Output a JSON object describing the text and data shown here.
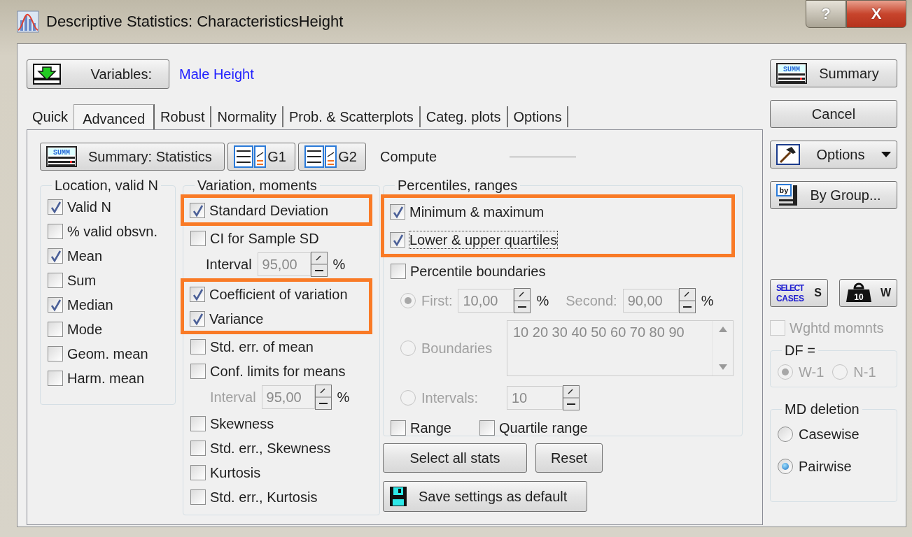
{
  "window": {
    "title": "Descriptive Statistics: CharacteristicsHeight",
    "help_button": "?",
    "close_button": "X"
  },
  "variables": {
    "button_label": "Variables:",
    "value": "Male Height"
  },
  "tabs": [
    {
      "label": "Quick",
      "selected": false
    },
    {
      "label": "Advanced",
      "selected": true
    },
    {
      "label": "Robust",
      "selected": false
    },
    {
      "label": "Normality",
      "selected": false
    },
    {
      "label": "Prob. & Scatterplots",
      "selected": false
    },
    {
      "label": "Categ. plots",
      "selected": false
    },
    {
      "label": "Options",
      "selected": false
    }
  ],
  "toolbar": {
    "summary_button": {
      "label": "Summary: Statistics",
      "icon_text": "SUMM"
    },
    "graph_buttons": [
      "G1",
      "G2"
    ],
    "compute_label": "Compute"
  },
  "location_group": {
    "title": "Location, valid N",
    "items": [
      {
        "label": "Valid N",
        "checked": true,
        "highlighted": false
      },
      {
        "label": "% valid obsvn.",
        "checked": false,
        "highlighted": false
      },
      {
        "label": "Mean",
        "checked": true,
        "highlighted": false
      },
      {
        "label": "Sum",
        "checked": false,
        "highlighted": false
      },
      {
        "label": "Median",
        "checked": true,
        "highlighted": false
      },
      {
        "label": "Mode",
        "checked": false,
        "highlighted": false
      },
      {
        "label": "Geom. mean",
        "checked": false,
        "highlighted": false
      },
      {
        "label": "Harm. mean",
        "checked": false,
        "highlighted": false
      }
    ]
  },
  "variation_group": {
    "title": "Variation, moments",
    "items": [
      {
        "kind": "checkbox",
        "label": "Standard Deviation",
        "checked": true,
        "highlighted": true
      },
      {
        "kind": "checkbox",
        "label": "CI for Sample SD",
        "checked": false,
        "highlighted": false
      },
      {
        "kind": "interval",
        "label": "Interval",
        "value": "95,00",
        "unit": "%",
        "disabled": false
      },
      {
        "kind": "checkbox",
        "label": "Coefficient of variation",
        "checked": true,
        "highlighted": true
      },
      {
        "kind": "checkbox",
        "label": "Variance",
        "checked": true,
        "highlighted": true
      },
      {
        "kind": "checkbox",
        "label": "Std. err. of mean",
        "checked": false,
        "highlighted": false
      },
      {
        "kind": "checkbox",
        "label": "Conf. limits for means",
        "checked": false,
        "highlighted": false
      },
      {
        "kind": "interval",
        "label": "Interval",
        "value": "95,00",
        "unit": "%",
        "disabled": true
      },
      {
        "kind": "checkbox",
        "label": "Skewness",
        "checked": false,
        "highlighted": false
      },
      {
        "kind": "checkbox",
        "label": "Std. err., Skewness",
        "checked": false,
        "highlighted": false
      },
      {
        "kind": "checkbox",
        "label": "Kurtosis",
        "checked": false,
        "highlighted": false
      },
      {
        "kind": "checkbox",
        "label": "Std. err., Kurtosis",
        "checked": false,
        "highlighted": false
      }
    ]
  },
  "percentiles_group": {
    "title": "Percentiles, ranges",
    "items": [
      {
        "label": "Minimum & maximum",
        "checked": true,
        "highlighted": true,
        "focused": false
      },
      {
        "label": "Lower & upper quartiles",
        "checked": true,
        "highlighted": true,
        "focused": true
      },
      {
        "label": "Percentile boundaries",
        "checked": false,
        "highlighted": false,
        "focused": false
      }
    ],
    "boundary_options": {
      "disabled": true,
      "first": {
        "label": "First:",
        "value": "10,00",
        "unit": "%",
        "selected": true
      },
      "second": {
        "label": "Second:",
        "value": "90,00",
        "unit": "%"
      },
      "boundaries": {
        "label": "Boundaries",
        "value": "10 20 30 40 50 60 70 80 90",
        "selected": false
      },
      "intervals": {
        "label": "Intervals:",
        "value": "10",
        "selected": false
      }
    },
    "ranges": [
      {
        "label": "Range",
        "checked": false
      },
      {
        "label": "Quartile range",
        "checked": false
      }
    ]
  },
  "action_buttons": [
    {
      "label": "Select all stats"
    },
    {
      "label": "Reset"
    }
  ],
  "save_button": {
    "label": "Save settings as default"
  },
  "side_buttons": [
    {
      "label": "Summary",
      "kind": "summary",
      "icon_text": "SUMM",
      "dropdown": false
    },
    {
      "label": "Cancel",
      "kind": "plain",
      "dropdown": false
    },
    {
      "label": "Options",
      "kind": "hammer",
      "dropdown": true
    },
    {
      "label": "By Group...",
      "kind": "by_group",
      "icon_text": "by",
      "dropdown": false
    }
  ],
  "case_buttons": {
    "select_cases": {
      "icon_text": [
        "SELECT",
        "CASES"
      ],
      "label": "S"
    },
    "weight": {
      "icon_text": "10",
      "label": "W"
    }
  },
  "weighted_moments": {
    "label": "Wghtd momnts",
    "checked": false,
    "disabled": true
  },
  "df_group": {
    "title": "DF =",
    "disabled": true,
    "options": [
      {
        "label": "W-1",
        "selected": true
      },
      {
        "label": "N-1",
        "selected": false
      }
    ]
  },
  "md_deletion": {
    "title": "MD deletion",
    "options": [
      {
        "label": "Casewise",
        "selected": false
      },
      {
        "label": "Pairwise",
        "selected": true
      }
    ]
  }
}
